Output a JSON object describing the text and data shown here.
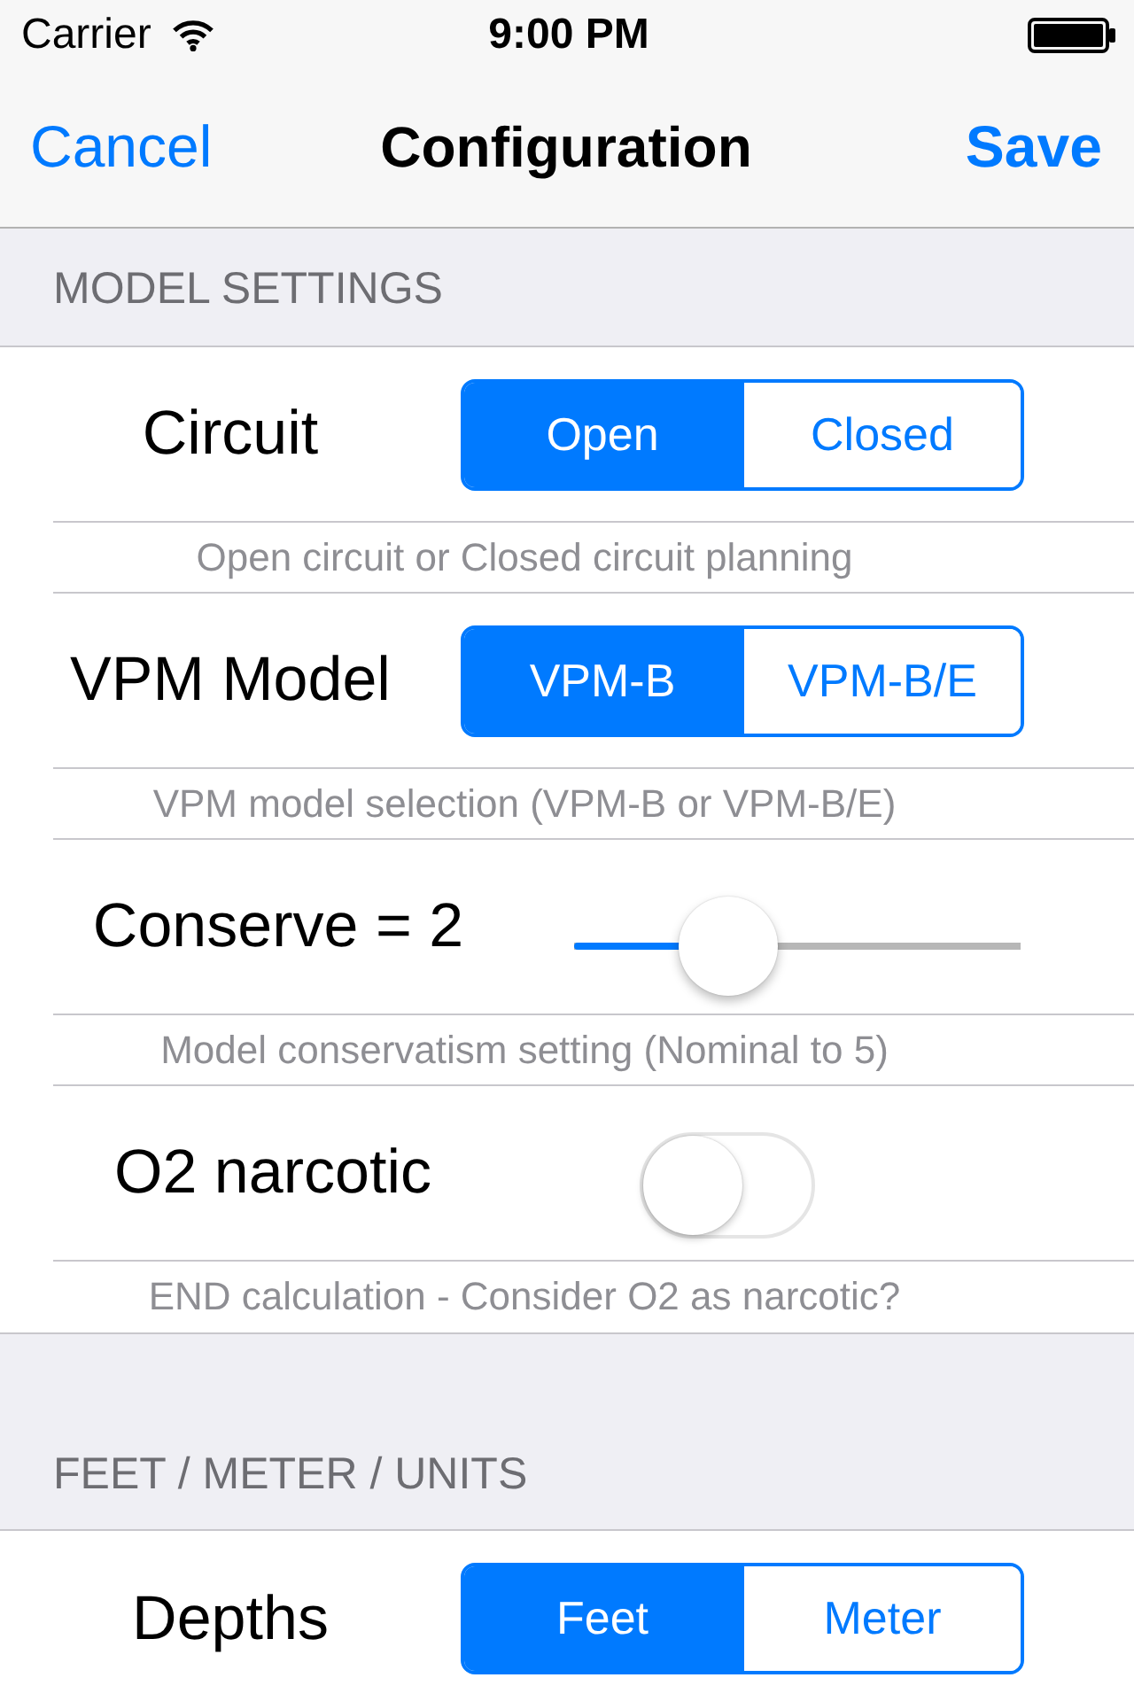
{
  "status_bar": {
    "carrier": "Carrier",
    "time": "9:00 PM"
  },
  "nav_bar": {
    "left_button": "Cancel",
    "title": "Configuration",
    "right_button": "Save"
  },
  "sections": [
    {
      "header": "MODEL SETTINGS",
      "rows": [
        {
          "kind": "segmented",
          "label": "Circuit",
          "options": [
            {
              "label": "Open",
              "selected": true
            },
            {
              "label": "Closed",
              "selected": false
            }
          ],
          "description": "Open circuit or Closed circuit planning"
        },
        {
          "kind": "segmented",
          "label": "VPM Model",
          "options": [
            {
              "label": "VPM-B",
              "selected": true
            },
            {
              "label": "VPM-B/E",
              "selected": false
            }
          ],
          "description": "VPM model selection (VPM-B or VPM-B/E)"
        },
        {
          "kind": "slider",
          "label": "Conserve = 2",
          "level": 0.3,
          "description": "Model conservatism setting (Nominal to 5)"
        },
        {
          "kind": "switch",
          "label": "O2 narcotic",
          "on": false,
          "description": "END calculation - Consider O2 as narcotic?"
        }
      ]
    },
    {
      "header": "FEET / METER / UNITS",
      "rows": [
        {
          "kind": "segmented",
          "label": "Depths",
          "options": [
            {
              "label": "Feet",
              "selected": true
            },
            {
              "label": "Meter",
              "selected": false
            }
          ]
        }
      ]
    }
  ]
}
